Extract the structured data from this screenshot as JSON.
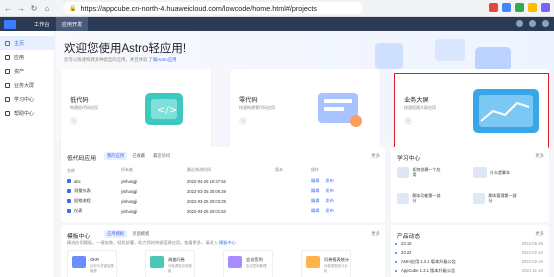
{
  "browser": {
    "url": "https://appcube.cn-north-4.huaweicloud.com/lowcode/home.html#/projects"
  },
  "header": {
    "tabs": [
      "工作台",
      "应用开发"
    ],
    "active_tab": 1
  },
  "sidebar": {
    "items": [
      {
        "label": "主页",
        "active": true
      },
      {
        "label": "应用",
        "active": false
      },
      {
        "label": "资产",
        "active": false
      },
      {
        "label": "业务大屏",
        "active": false
      },
      {
        "label": "学习中心",
        "active": false
      },
      {
        "label": "帮助中心",
        "active": false
      }
    ]
  },
  "hero": {
    "welcome": "欢迎您使用Astro轻应用!",
    "subtitle": "您可以快速构建多种类型的应用，并且体验",
    "link": "了解Astro应用"
  },
  "cards": [
    {
      "title": "低代码",
      "desc": "构建低代码应用"
    },
    {
      "title": "零代码",
      "desc": "快速构建零代码应用"
    },
    {
      "title": "业务大屏",
      "desc": "快速搭建大屏应用"
    }
  ],
  "lowcode": {
    "title": "低代码应用",
    "tabs": [
      "我的应用",
      "已收藏",
      "最近访问"
    ],
    "more": "更多",
    "headers": [
      "名称",
      "所有者",
      "最近修改时间",
      "版本",
      "操作"
    ],
    "rows": [
      {
        "name": "abc",
        "owner": "yishangji",
        "time": "2022-04-25 10:37:52",
        "v1": "编辑",
        "v2": "发布"
      },
      {
        "name": "测量仪表",
        "owner": "yishangji",
        "time": "2022-03-25 20:06:29",
        "v1": "编辑",
        "v2": "发布"
      },
      {
        "name": "投物流程",
        "owner": "yishangji",
        "time": "2022-03-25 20:03:29",
        "v1": "编辑",
        "v2": "发布"
      },
      {
        "name": "仪表",
        "owner": "yishangji",
        "time": "2022-03-25 20:01:53",
        "v1": "编辑",
        "v2": "发布"
      }
    ]
  },
  "learn": {
    "title": "学习中心",
    "more": "更多",
    "items": [
      {
        "label": "如何创建一个应用"
      },
      {
        "label": "什么是脚本"
      },
      {
        "label": "脚本功能第一部分"
      },
      {
        "label": "脚本管理第一部分"
      }
    ]
  },
  "templates": {
    "title": "模板中心",
    "tabs": [
      "应用模板",
      "页面模板"
    ],
    "more": "更多",
    "desc": "精选应用模板，一键安装，轻松部署，助力您的快速搭建应用。查看更多，请进入",
    "link": "模板中心",
    "items": [
      {
        "name": "OKR",
        "desc": "目标与关键结果管理"
      },
      {
        "name": "调查问卷",
        "desc": "问卷调查应用模板"
      },
      {
        "name": "会议签到",
        "desc": "会议签到管理"
      },
      {
        "name": "问卷报表统计",
        "desc": "问卷报表统计分析"
      }
    ]
  },
  "news": {
    "title": "产品动态",
    "more": "更多",
    "items": [
      {
        "label": "23.10",
        "date": "2022-05-26"
      },
      {
        "label": "23.22",
        "date": "2022-02-24"
      },
      {
        "label": "Astro应用 1.3.1 版本升级公告",
        "date": "2022-02-15"
      },
      {
        "label": "AppCube 1.3.1 版本升级公告",
        "date": "2021-11-23"
      }
    ]
  }
}
